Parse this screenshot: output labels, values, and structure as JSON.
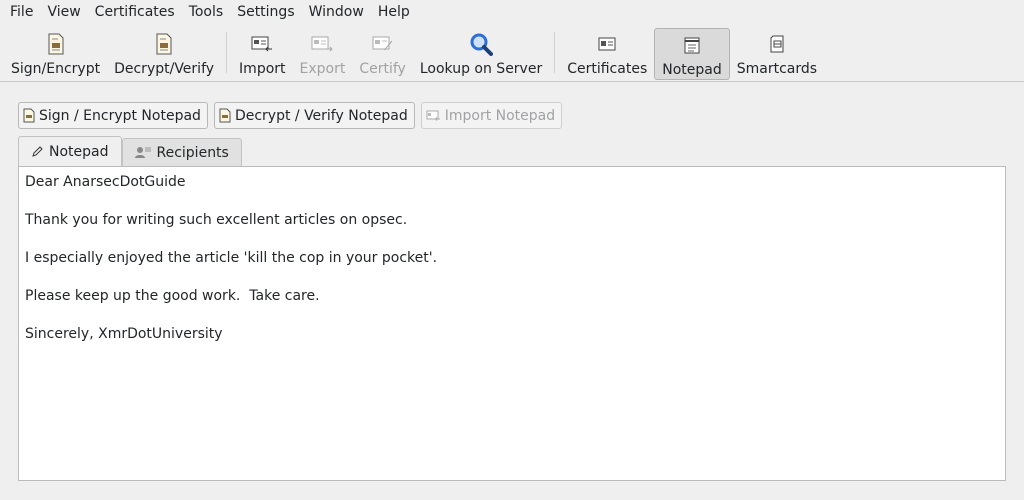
{
  "menu": [
    {
      "label": "File"
    },
    {
      "label": "View"
    },
    {
      "label": "Certificates"
    },
    {
      "label": "Tools"
    },
    {
      "label": "Settings"
    },
    {
      "label": "Window"
    },
    {
      "label": "Help"
    }
  ],
  "toolbar": {
    "sign_encrypt": "Sign/Encrypt",
    "decrypt_verify": "Decrypt/Verify",
    "import": "Import",
    "export": "Export",
    "certify": "Certify",
    "lookup": "Lookup on Server",
    "certificates": "Certificates",
    "notepad": "Notepad",
    "smartcards": "Smartcards"
  },
  "actions": {
    "sign_encrypt": "Sign / Encrypt Notepad",
    "decrypt_verify": "Decrypt / Verify Notepad",
    "import": "Import Notepad"
  },
  "tabs": {
    "notepad": "Notepad",
    "recipients": "Recipients"
  },
  "editor": {
    "lines": [
      "Dear AnarsecDotGuide",
      "",
      "Thank you for writing such excellent articles on opsec.",
      "",
      "I especially enjoyed the article 'kill the cop in your pocket'.",
      "",
      "Please keep up the good work.  Take care.",
      "",
      "Sincerely, XmrDotUniversity"
    ]
  },
  "colors": {
    "background": "#efefef",
    "text": "#232629",
    "disabled": "#a0a2a4",
    "lookup_icon": "#2e6fd6"
  }
}
